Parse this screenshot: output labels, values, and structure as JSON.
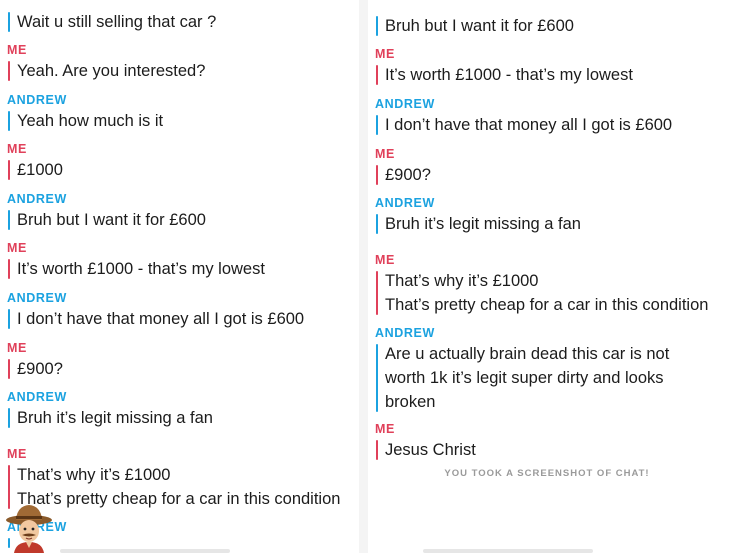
{
  "left_panel": {
    "messages": [
      {
        "sender": "",
        "text": "Wait u still selling that car ?"
      },
      {
        "sender": "ME",
        "text": "Yeah. Are you interested?"
      },
      {
        "sender": "ANDREW",
        "text": "Yeah how much is it"
      },
      {
        "sender": "ME",
        "text": "£1000"
      },
      {
        "sender": "ANDREW",
        "text": "Bruh but I want it for £600"
      },
      {
        "sender": "ME",
        "text": "It’s worth £1000 - that’s my lowest"
      },
      {
        "sender": "ANDREW",
        "text": "I don’t have that money all I got is £600"
      },
      {
        "sender": "ME",
        "text": "£900?"
      },
      {
        "sender": "ANDREW",
        "text": "Bruh it’s legit missing a fan"
      },
      {
        "sender": "ME",
        "text_lines": [
          "That’s why it’s £1000",
          "That’s pretty cheap for a car in this condition"
        ]
      },
      {
        "sender": "ANDREW",
        "text": ""
      }
    ]
  },
  "right_panel": {
    "messages": [
      {
        "sender": "",
        "text": "Bruh but I want it for £600"
      },
      {
        "sender": "ME",
        "text": "It’s worth £1000 - that’s my lowest"
      },
      {
        "sender": "ANDREW",
        "text": "I don’t have that money all I got is £600"
      },
      {
        "sender": "ME",
        "text": "£900?"
      },
      {
        "sender": "ANDREW",
        "text": "Bruh it’s legit missing a fan"
      },
      {
        "sender": "ME",
        "text_lines": [
          "That’s why it’s £1000",
          "That’s pretty cheap for a car in this condition"
        ]
      },
      {
        "sender": "ANDREW",
        "text": "Are u actually brain dead this car is not worth 1k it’s legit super dirty and looks broken"
      },
      {
        "sender": "ME",
        "text": "Jesus Christ"
      }
    ],
    "system_notice": "YOU TOOK A SCREENSHOT OF CHAT!"
  },
  "colors": {
    "me": "#e0405a",
    "andrew": "#1ba2e0",
    "system": "#9a9a9a"
  },
  "icons": {
    "avatar": "cowboy-bitmoji-avatar"
  }
}
